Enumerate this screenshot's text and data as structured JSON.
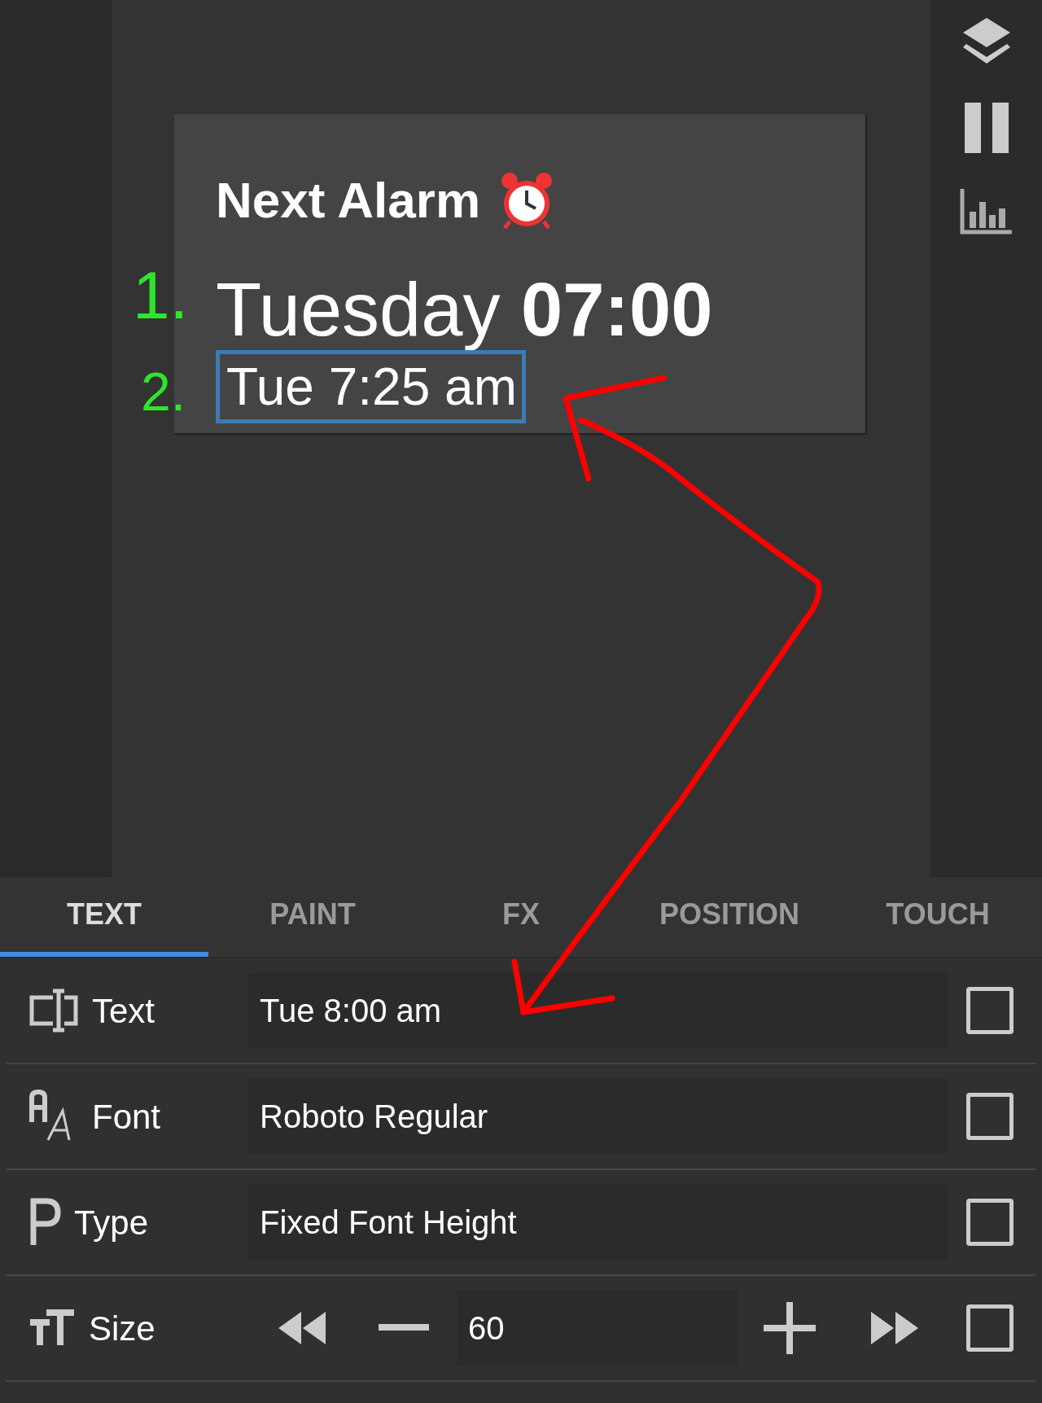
{
  "widget": {
    "title": "Next Alarm",
    "lines": [
      {
        "text": "Tuesday **07:00**",
        "selected": false
      },
      {
        "text": "Tue 7:25 am",
        "selected": true
      }
    ]
  },
  "annotations": {
    "markers": [
      "1.",
      "2."
    ]
  },
  "tabs": [
    {
      "label": "TEXT",
      "selected": true
    },
    {
      "label": "PAINT",
      "selected": false
    },
    {
      "label": "FX",
      "selected": false
    },
    {
      "label": "POSITION",
      "selected": false
    },
    {
      "label": "TOUCH",
      "selected": false
    }
  ],
  "properties": [
    {
      "kind": "text",
      "label": "Text",
      "value": "Tue 8:00 am",
      "checked": false
    },
    {
      "kind": "font",
      "label": "Font",
      "value": "Roboto Regular",
      "checked": false
    },
    {
      "kind": "type",
      "label": "Type",
      "value": "Fixed Font Height",
      "checked": false
    },
    {
      "kind": "size",
      "label": "Size",
      "value": "60",
      "checked": false
    }
  ]
}
